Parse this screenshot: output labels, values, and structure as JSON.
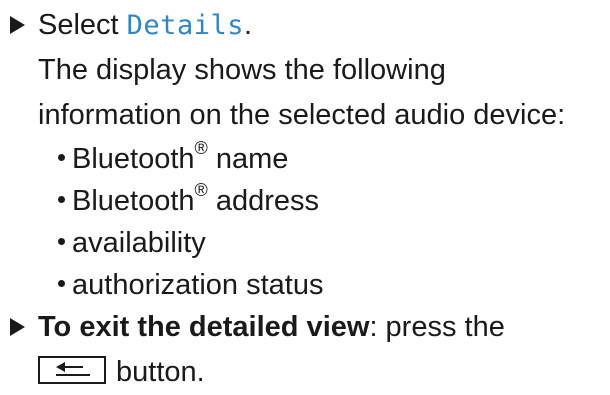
{
  "step1": {
    "prefix": "Select ",
    "ui_term": "Details",
    "suffix": "."
  },
  "paragraph": {
    "line1": "The display shows the following",
    "line2": "information on the selected audio device:"
  },
  "bullets": [
    {
      "text": "Bluetooth",
      "sup": "®",
      "rest": " name"
    },
    {
      "text": "Bluetooth",
      "sup": "®",
      "rest": " address"
    },
    {
      "text": "availability",
      "sup": "",
      "rest": ""
    },
    {
      "text": "authorization status",
      "sup": "",
      "rest": ""
    }
  ],
  "step2": {
    "bold": "To exit the detailed view",
    "rest": ": press the",
    "button_icon": "back-arrow-icon",
    "after_button": "button."
  }
}
